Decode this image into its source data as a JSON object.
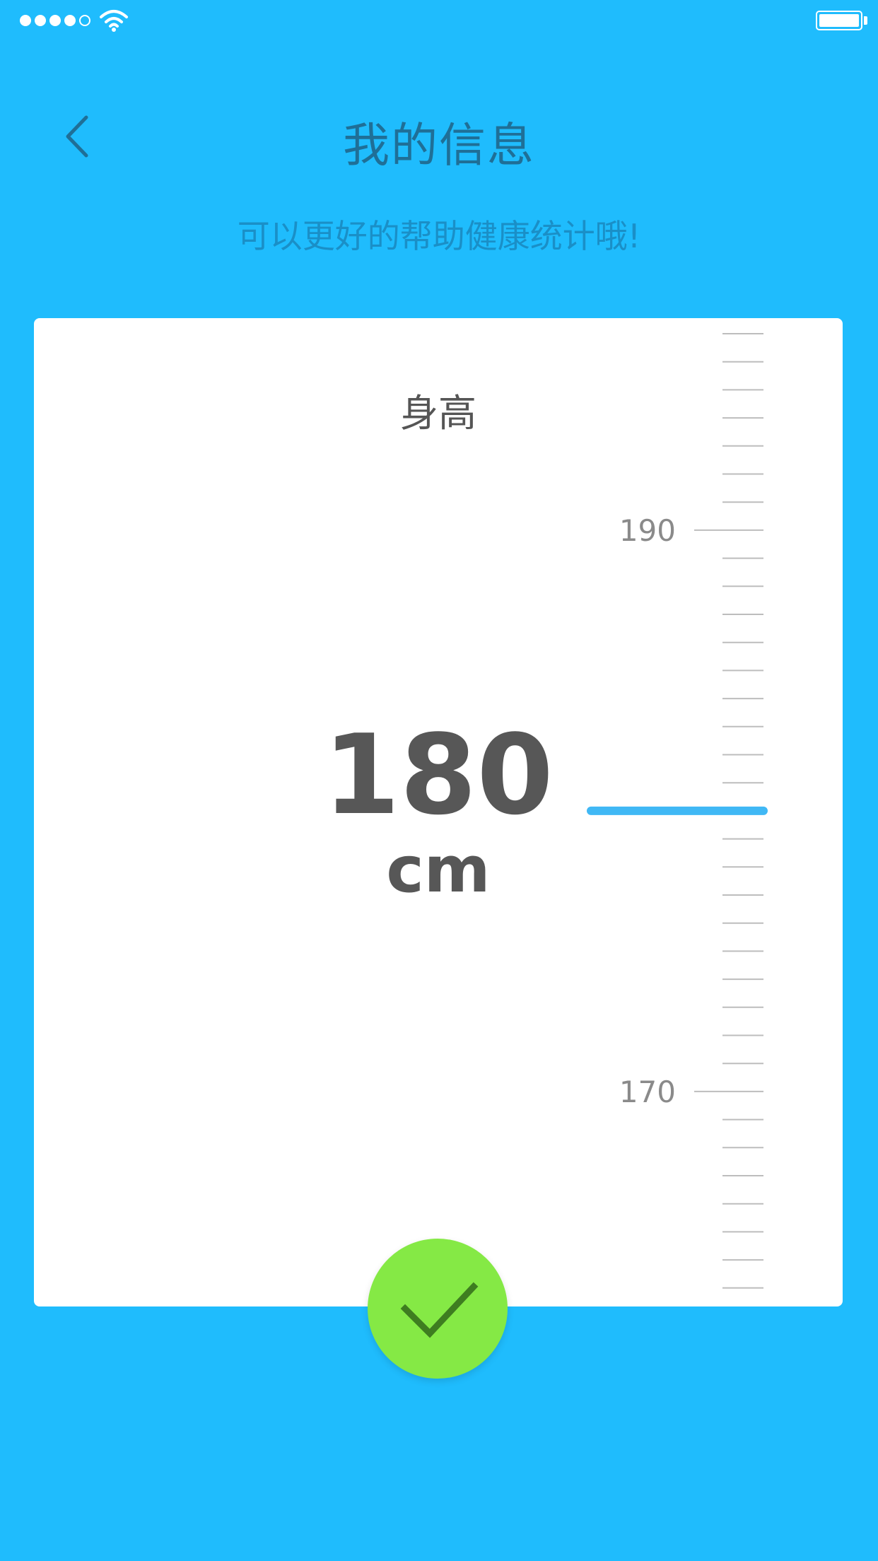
{
  "statusbar": {
    "signal_total": 5,
    "signal_filled": 4
  },
  "header": {
    "title": "我的信息",
    "subtitle": "可以更好的帮助健康统计哦!"
  },
  "measure": {
    "label": "身高",
    "value": "180",
    "unit": "cm",
    "ruler": {
      "major_labels": [
        "190",
        "170"
      ],
      "tick_color": "#bdbdbd",
      "indicator_color": "#40b8f5"
    }
  },
  "colors": {
    "background": "#1fbcfd",
    "card": "#ffffff",
    "confirm": "#85e945",
    "check": "#3e7d20"
  },
  "icons": {
    "back": "chevron-left-icon",
    "confirm": "check-icon"
  }
}
